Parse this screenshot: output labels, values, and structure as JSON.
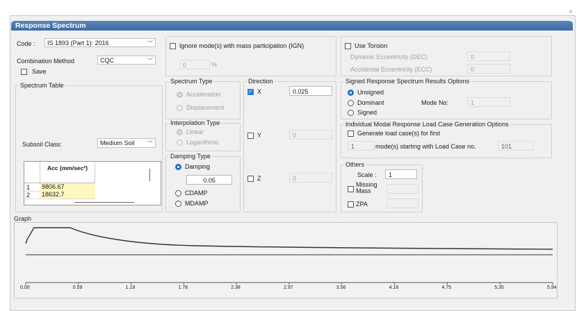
{
  "dialog": {
    "title": "Response Spectrum",
    "close_glyph": "×"
  },
  "code": {
    "label": "Code :",
    "value": "IS 1893 (Part 1): 2016"
  },
  "combination": {
    "label": "Combination Method",
    "value": "CQC"
  },
  "save": {
    "label": "Save",
    "checked": false
  },
  "spectrum_table": {
    "legend": "Spectrum Table",
    "subsoil_label": "Subsoil Class:",
    "subsoil_value": "Medium Soil",
    "column_header": "Acc (mm/sec²)",
    "rows": [
      {
        "index": "1",
        "value": "9806.67"
      },
      {
        "index": "2",
        "value": "18632.7"
      }
    ]
  },
  "ign": {
    "label": "Ignore mode(s) with mass participation (IGN)",
    "value": "0",
    "unit": "%"
  },
  "spectrum_type": {
    "legend": "Spectrum Type",
    "options": [
      "Acceleration",
      "Displacement"
    ]
  },
  "interpolation": {
    "legend": "Interpolation Type",
    "options": [
      "Linear",
      "Logarithmic"
    ]
  },
  "damping": {
    "legend": "Damping Type",
    "options": [
      "Damping",
      "CDAMP",
      "MDAMP"
    ],
    "value": "0.05"
  },
  "direction": {
    "legend": "Direction",
    "x_label": "X",
    "x_value": "0.025",
    "y_label": "Y",
    "y_value": "0",
    "z_label": "Z",
    "z_value": "0"
  },
  "torsion": {
    "label": "Use Torsion",
    "dec_label": "Dynamic Eccentricity (DEC)",
    "dec_value": "0",
    "ecc_label": "Accidental Eccentricity (ECC)",
    "ecc_value": "0"
  },
  "signed": {
    "legend": "Signed Response Spectrum Results Options",
    "options": [
      "Unsigned",
      "Dominant",
      "Signed"
    ],
    "mode_no_label": "Mode No:",
    "mode_no_value": "1"
  },
  "individual": {
    "legend": "Individual Modal Response Load Case Generation Options",
    "generate_label": "Generate load case(s) for first",
    "count_value": "1",
    "mid_text": "mode(s) starting with Load Case no.",
    "start_value": "101"
  },
  "others": {
    "legend": "Others",
    "scale_label": "Scale :",
    "scale_value": "1",
    "missing_mass_label": "Missing Mass",
    "zpa_label": "ZPA"
  },
  "graph": {
    "legend": "Graph",
    "x_ticks": [
      "0.00",
      "0.59",
      "1.19",
      "1.78",
      "2.38",
      "2.97",
      "3.56",
      "4.16",
      "4.75",
      "5.35",
      "5.94"
    ]
  }
}
